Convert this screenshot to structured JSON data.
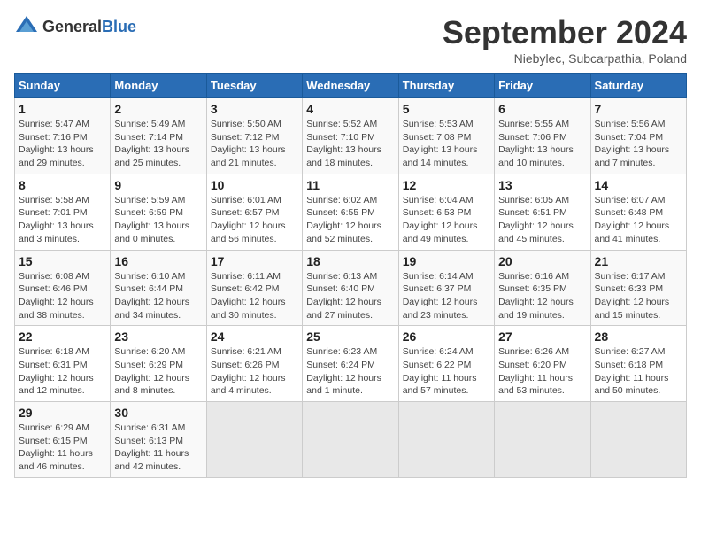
{
  "header": {
    "logo_general": "General",
    "logo_blue": "Blue",
    "month_title": "September 2024",
    "subtitle": "Niebylec, Subcarpathia, Poland"
  },
  "days_of_week": [
    "Sunday",
    "Monday",
    "Tuesday",
    "Wednesday",
    "Thursday",
    "Friday",
    "Saturday"
  ],
  "weeks": [
    [
      {
        "day": "1",
        "info": "Sunrise: 5:47 AM\nSunset: 7:16 PM\nDaylight: 13 hours\nand 29 minutes."
      },
      {
        "day": "2",
        "info": "Sunrise: 5:49 AM\nSunset: 7:14 PM\nDaylight: 13 hours\nand 25 minutes."
      },
      {
        "day": "3",
        "info": "Sunrise: 5:50 AM\nSunset: 7:12 PM\nDaylight: 13 hours\nand 21 minutes."
      },
      {
        "day": "4",
        "info": "Sunrise: 5:52 AM\nSunset: 7:10 PM\nDaylight: 13 hours\nand 18 minutes."
      },
      {
        "day": "5",
        "info": "Sunrise: 5:53 AM\nSunset: 7:08 PM\nDaylight: 13 hours\nand 14 minutes."
      },
      {
        "day": "6",
        "info": "Sunrise: 5:55 AM\nSunset: 7:06 PM\nDaylight: 13 hours\nand 10 minutes."
      },
      {
        "day": "7",
        "info": "Sunrise: 5:56 AM\nSunset: 7:04 PM\nDaylight: 13 hours\nand 7 minutes."
      }
    ],
    [
      {
        "day": "8",
        "info": "Sunrise: 5:58 AM\nSunset: 7:01 PM\nDaylight: 13 hours\nand 3 minutes."
      },
      {
        "day": "9",
        "info": "Sunrise: 5:59 AM\nSunset: 6:59 PM\nDaylight: 13 hours\nand 0 minutes."
      },
      {
        "day": "10",
        "info": "Sunrise: 6:01 AM\nSunset: 6:57 PM\nDaylight: 12 hours\nand 56 minutes."
      },
      {
        "day": "11",
        "info": "Sunrise: 6:02 AM\nSunset: 6:55 PM\nDaylight: 12 hours\nand 52 minutes."
      },
      {
        "day": "12",
        "info": "Sunrise: 6:04 AM\nSunset: 6:53 PM\nDaylight: 12 hours\nand 49 minutes."
      },
      {
        "day": "13",
        "info": "Sunrise: 6:05 AM\nSunset: 6:51 PM\nDaylight: 12 hours\nand 45 minutes."
      },
      {
        "day": "14",
        "info": "Sunrise: 6:07 AM\nSunset: 6:48 PM\nDaylight: 12 hours\nand 41 minutes."
      }
    ],
    [
      {
        "day": "15",
        "info": "Sunrise: 6:08 AM\nSunset: 6:46 PM\nDaylight: 12 hours\nand 38 minutes."
      },
      {
        "day": "16",
        "info": "Sunrise: 6:10 AM\nSunset: 6:44 PM\nDaylight: 12 hours\nand 34 minutes."
      },
      {
        "day": "17",
        "info": "Sunrise: 6:11 AM\nSunset: 6:42 PM\nDaylight: 12 hours\nand 30 minutes."
      },
      {
        "day": "18",
        "info": "Sunrise: 6:13 AM\nSunset: 6:40 PM\nDaylight: 12 hours\nand 27 minutes."
      },
      {
        "day": "19",
        "info": "Sunrise: 6:14 AM\nSunset: 6:37 PM\nDaylight: 12 hours\nand 23 minutes."
      },
      {
        "day": "20",
        "info": "Sunrise: 6:16 AM\nSunset: 6:35 PM\nDaylight: 12 hours\nand 19 minutes."
      },
      {
        "day": "21",
        "info": "Sunrise: 6:17 AM\nSunset: 6:33 PM\nDaylight: 12 hours\nand 15 minutes."
      }
    ],
    [
      {
        "day": "22",
        "info": "Sunrise: 6:18 AM\nSunset: 6:31 PM\nDaylight: 12 hours\nand 12 minutes."
      },
      {
        "day": "23",
        "info": "Sunrise: 6:20 AM\nSunset: 6:29 PM\nDaylight: 12 hours\nand 8 minutes."
      },
      {
        "day": "24",
        "info": "Sunrise: 6:21 AM\nSunset: 6:26 PM\nDaylight: 12 hours\nand 4 minutes."
      },
      {
        "day": "25",
        "info": "Sunrise: 6:23 AM\nSunset: 6:24 PM\nDaylight: 12 hours\nand 1 minute."
      },
      {
        "day": "26",
        "info": "Sunrise: 6:24 AM\nSunset: 6:22 PM\nDaylight: 11 hours\nand 57 minutes."
      },
      {
        "day": "27",
        "info": "Sunrise: 6:26 AM\nSunset: 6:20 PM\nDaylight: 11 hours\nand 53 minutes."
      },
      {
        "day": "28",
        "info": "Sunrise: 6:27 AM\nSunset: 6:18 PM\nDaylight: 11 hours\nand 50 minutes."
      }
    ],
    [
      {
        "day": "29",
        "info": "Sunrise: 6:29 AM\nSunset: 6:15 PM\nDaylight: 11 hours\nand 46 minutes."
      },
      {
        "day": "30",
        "info": "Sunrise: 6:31 AM\nSunset: 6:13 PM\nDaylight: 11 hours\nand 42 minutes."
      },
      {
        "day": "",
        "info": ""
      },
      {
        "day": "",
        "info": ""
      },
      {
        "day": "",
        "info": ""
      },
      {
        "day": "",
        "info": ""
      },
      {
        "day": "",
        "info": ""
      }
    ]
  ]
}
